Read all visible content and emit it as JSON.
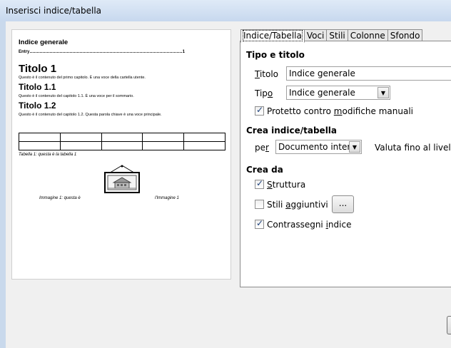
{
  "window": {
    "title": "Inserisci indice/tabella"
  },
  "preview": {
    "heading": "Indice generale",
    "entry_text": "Entry",
    "entry_page": "1",
    "h1": "Titolo 1",
    "h1_text": "Questo è il contenuto del primo capitolo. È una voce della cartella utente.",
    "h11": "Titolo 1.1",
    "h11_text": "Questo è il contenuto del capitolo 1.1. È una voce per il sommario.",
    "h12": "Titolo 1.2",
    "h12_text": "Questo è il contenuto del capitolo 1.2. Questa parola chiave è una voce principale.",
    "table_caption": "Tabella 1: questa è la tabella 1",
    "image_caption_left": "Immagine 1: questa è",
    "image_caption_right": "l'Immagine 1"
  },
  "tabs": [
    "Indice/Tabella",
    "Voci",
    "Stili",
    "Colonne",
    "Sfondo"
  ],
  "type_title": {
    "section": "Tipo e titolo",
    "title_label": "Titolo",
    "title_value": "Indice generale",
    "type_label": "Tipo",
    "type_value": "Indice generale",
    "protected_label": "Protetto contro modifiche manuali",
    "protected_checked": true
  },
  "create": {
    "section": "Crea indice/tabella",
    "for_label": "per",
    "for_value": "Documento intero",
    "eval_label": "Valuta fino al livello"
  },
  "create_from": {
    "section": "Crea da",
    "structure_label": "Struttura",
    "structure_checked": true,
    "extra_styles_label": "Stili aggiuntivi",
    "extra_styles_checked": false,
    "extra_styles_button": "...",
    "index_marks_label": "Contrassegni indice",
    "index_marks_checked": true
  },
  "colors": {
    "titlebar": "#c7d8ee",
    "dialog_bg": "#f0f0f0",
    "check": "#1b3f7a"
  }
}
